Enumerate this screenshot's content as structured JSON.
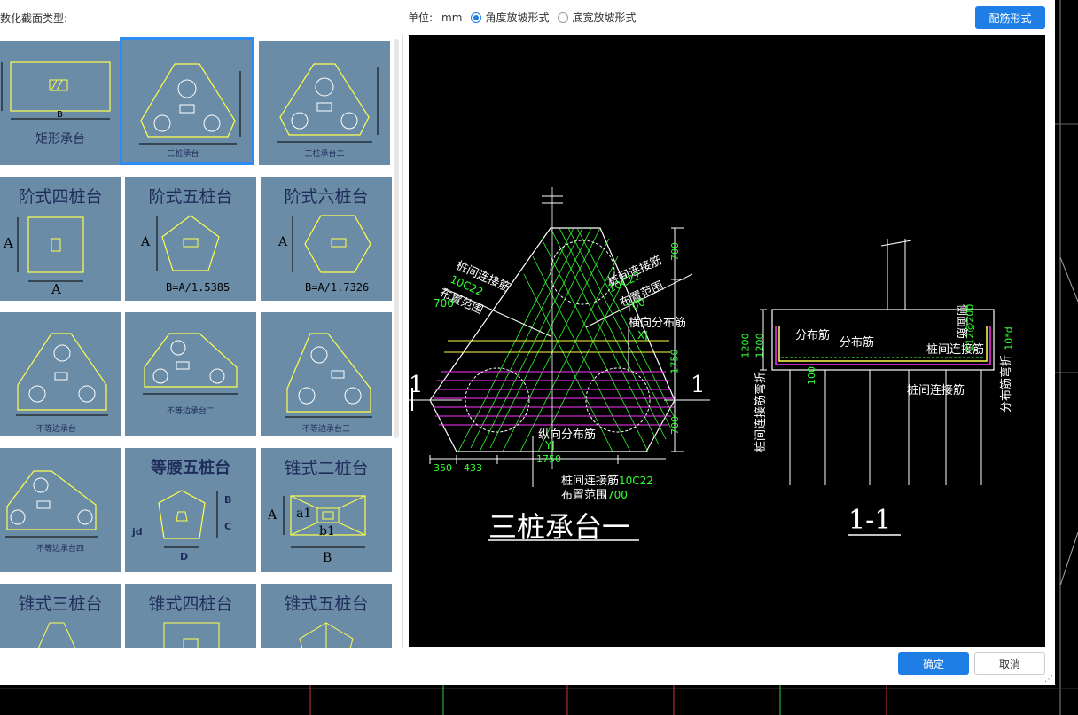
{
  "dialog": {
    "section_label": "数化截面类型:",
    "unit_label": "单位:",
    "unit_value": "mm",
    "radio_angle": "角度放坡形式",
    "radio_width": "底宽放坡形式",
    "rebar_button": "配筋形式",
    "ok_button": "确定",
    "cancel_button": "取消"
  },
  "thumbnails": [
    {
      "label": "矩形承台",
      "dim": "B"
    },
    {
      "label": "三桩承台一"
    },
    {
      "label": "三桩承台二"
    },
    {
      "label": "阶式四桩台",
      "dim_a": "A",
      "dim_b": "A"
    },
    {
      "label": "阶式五桩台",
      "dim_a": "A",
      "formula": "B=A/1.5385"
    },
    {
      "label": "阶式六桩台",
      "dim_a": "A",
      "formula": "B=A/1.7326"
    },
    {
      "label": "不等边承台一"
    },
    {
      "label": "不等边承台二"
    },
    {
      "label": "不等边承台三"
    },
    {
      "label": "不等边承台四"
    },
    {
      "label": "等腰五桩台",
      "dim_b": "B",
      "dim_c": "C",
      "dim_d": "D",
      "dim_jd": "jd"
    },
    {
      "label": "锥式二桩台",
      "dim_a": "A",
      "dim_a1": "a1",
      "dim_b1": "b1",
      "dim_b": "B"
    },
    {
      "label": "锥式三桩台"
    },
    {
      "label": "锥式四桩台"
    },
    {
      "label": "锥式五桩台"
    }
  ],
  "drawing": {
    "title": "三桩承台一",
    "section_title": "1-1",
    "section_mark": "1",
    "dims": {
      "top": "700",
      "mid": "1750",
      "bot": "700",
      "base_a": "350",
      "base_b": "433",
      "base_c": "1750",
      "h1": "1200",
      "h2": "1200",
      "h3": "100"
    },
    "labels": {
      "pile_conn": "桩间连接筋",
      "pile_conn_spec": "10C22",
      "layout_range": "布置范围",
      "layout_range_val": "700",
      "transverse": "横向分布筋",
      "xj": "XJ",
      "longitudinal": "纵向分布筋",
      "yj": "YJ",
      "dist": "分布筋",
      "side": "侧面筋",
      "side_spec": "C12@200",
      "bend": "分布筋弯折",
      "bend_val": "10*d",
      "pile_bend": "桩间连接筋弯折"
    }
  },
  "colors": {
    "accent": "#1e7ee6",
    "thumb_bg": "#6b8ca6",
    "cad_yellow": "#ffff4d",
    "cad_green": "#33ff33",
    "cad_magenta": "#ff33ff"
  }
}
